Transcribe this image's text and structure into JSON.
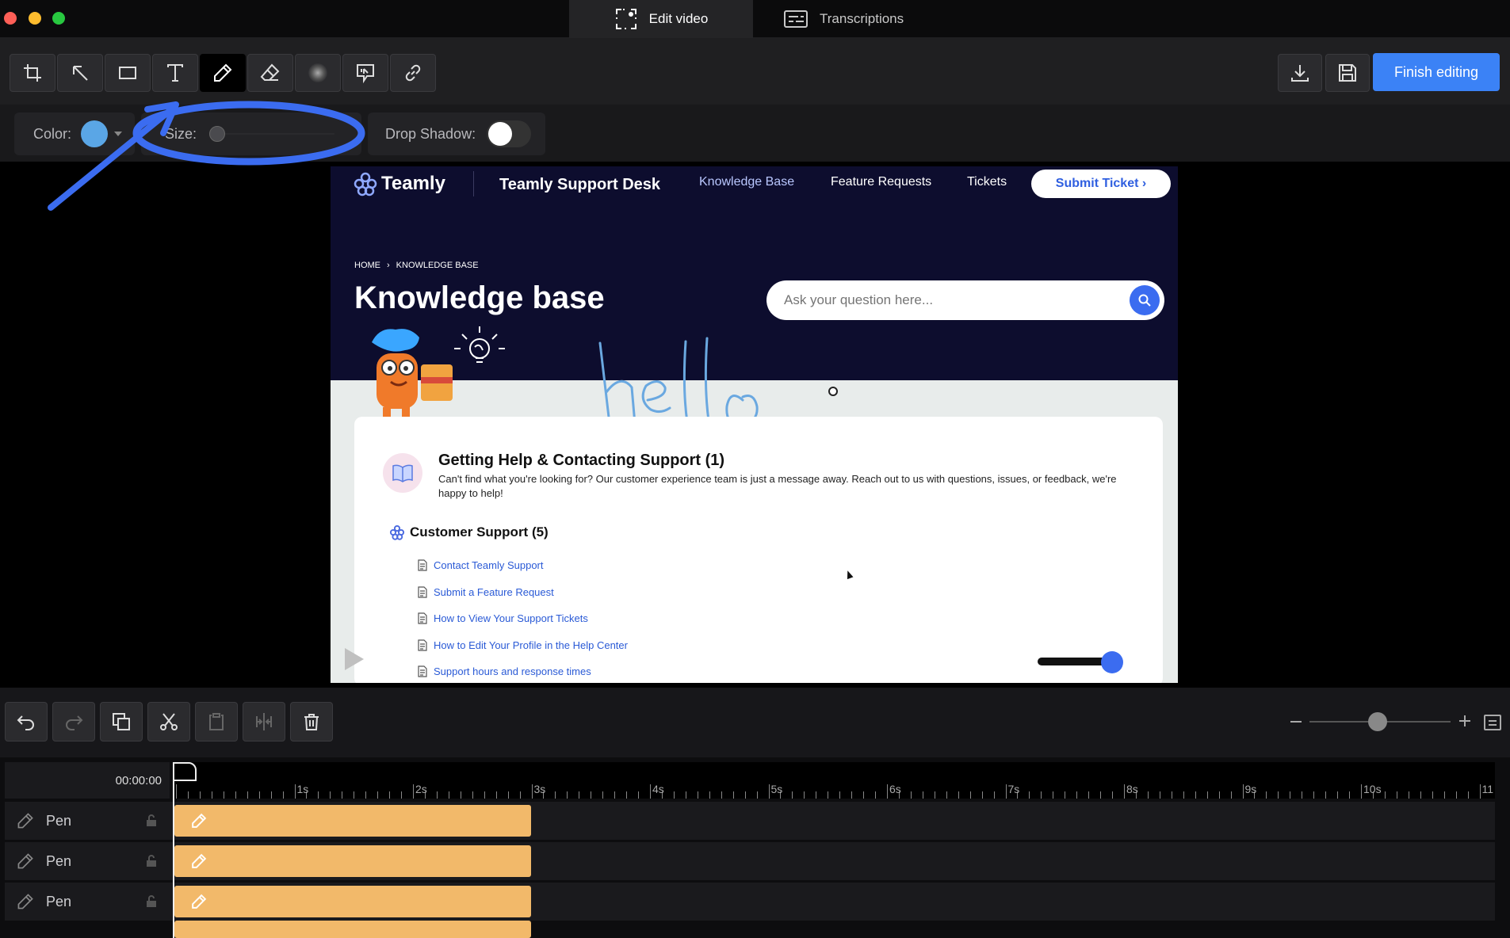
{
  "window": {
    "tabs": [
      {
        "label": "Edit video",
        "icon": "select-frame-icon",
        "active": true
      },
      {
        "label": "Transcriptions",
        "icon": "subtitles-icon",
        "active": false
      }
    ]
  },
  "toolbar": {
    "tools": [
      "crop-icon",
      "arrow-icon",
      "rectangle-icon",
      "text-icon",
      "pen-icon",
      "eraser-icon",
      "blur-icon",
      "callout-icon",
      "link-icon"
    ],
    "selected_tool": "pen-icon",
    "finish_label": "Finish editing"
  },
  "options": {
    "color_label": "Color:",
    "color_value": "#5aa6e6",
    "size_label": "Size:",
    "shadow_label": "Drop Shadow:",
    "shadow_on": false
  },
  "annotation_color": "#3b6cf0",
  "video": {
    "brand": "Teamly",
    "site_title": "Teamly Support Desk",
    "nav": [
      "Knowledge Base",
      "Feature Requests",
      "Tickets"
    ],
    "submit_label": "Submit Ticket ›",
    "breadcrumb_home": "HOME",
    "breadcrumb_sep": "›",
    "breadcrumb_current": "KNOWLEDGE BASE",
    "heading": "Knowledge base",
    "search_placeholder": "Ask your question here...",
    "handwriting": "hello",
    "section_title": "Getting Help & Contacting Support (1)",
    "section_desc": "Can't find what you're looking for? Our customer experience team is just a message away. Reach out to us with questions, issues, or feedback, we're happy to help!",
    "category": "Customer Support (5)",
    "articles": [
      "Contact Teamly Support",
      "Submit a Feature Request",
      "How to View Your Support Tickets",
      "How to Edit Your Profile in the Help Center",
      "Support hours and response times"
    ]
  },
  "timeline": {
    "timecode": "00:00:00",
    "ticks": [
      "1s",
      "2s",
      "3s",
      "4s",
      "5s",
      "6s",
      "7s",
      "8s",
      "9s",
      "10s",
      "11"
    ],
    "tracks": [
      {
        "label": "Pen"
      },
      {
        "label": "Pen"
      },
      {
        "label": "Pen"
      }
    ]
  }
}
